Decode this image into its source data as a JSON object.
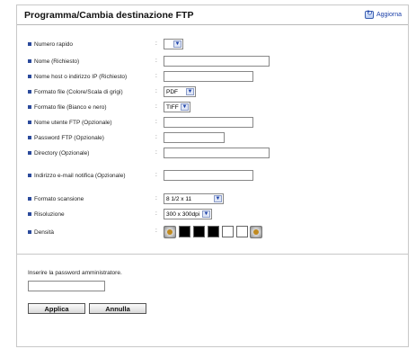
{
  "header": {
    "title": "Programma/Cambia destinazione FTP",
    "refresh_label": "Aggiorna"
  },
  "form": {
    "speed_dial": {
      "label": "Numero rapido",
      "value": ""
    },
    "name": {
      "label": "Nome (Richiesto)",
      "value": ""
    },
    "host": {
      "label": "Nome host o indirizzo IP (Richiesto)",
      "value": ""
    },
    "file_format_color": {
      "label": "Formato file (Colore/Scala di grigi)",
      "value": "PDF"
    },
    "file_format_bw": {
      "label": "Formato file (Bianco e nero)",
      "value": "TIFF"
    },
    "ftp_user": {
      "label": "Nome utente FTP (Opzionale)",
      "value": ""
    },
    "ftp_password": {
      "label": "Password FTP (Opzionale)",
      "value": ""
    },
    "directory": {
      "label": "Directory (Opzionale)",
      "value": ""
    },
    "notify_email": {
      "label": "Indirizzo e-mail notifica (Opzionale)",
      "value": ""
    },
    "scan_format": {
      "label": "Formato scansione",
      "value": "8 1/2 x 11"
    },
    "resolution": {
      "label": "Risoluzione",
      "value": "300 x 300dpi"
    },
    "density": {
      "label": "Densità",
      "level": 3,
      "steps": 5
    }
  },
  "admin": {
    "password_label": "Inserire la password amministratore.",
    "password_value": ""
  },
  "buttons": {
    "apply": "Applica",
    "cancel": "Annulla"
  },
  "colors": {
    "bullet": "#2b4a9c",
    "link": "#1a3fa8",
    "border": "#c8c8c8"
  }
}
